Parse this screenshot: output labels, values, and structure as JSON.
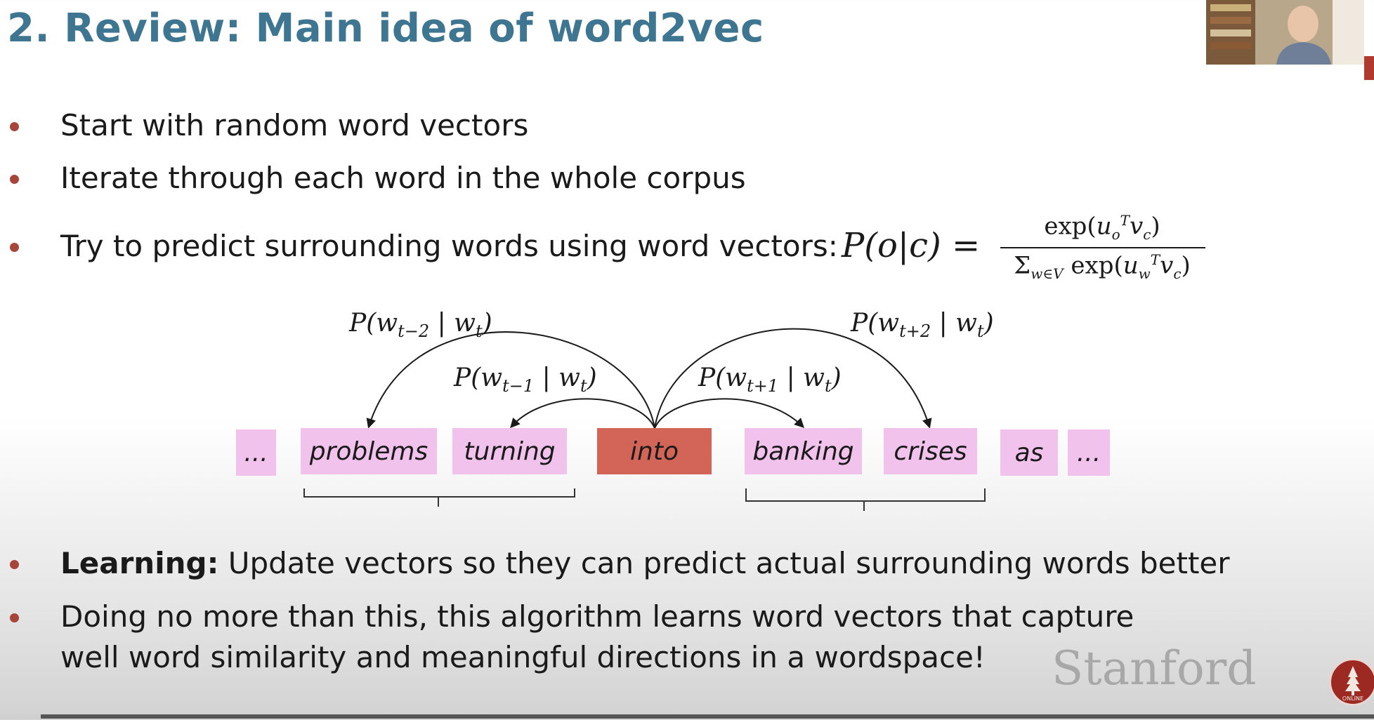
{
  "slide": {
    "title": "2. Review: Main idea of word2vec",
    "bullets": [
      "Start with random word vectors",
      "Iterate through each word in the whole corpus",
      "Try to predict surrounding words using word vectors:"
    ],
    "learning_label": "Learning:",
    "learning_text": " Update vectors so they can predict actual surrounding words better",
    "last_bullet_line1": "Doing no more than this, this algorithm learns word vectors that capture",
    "last_bullet_line2": "well word similarity and meaningful directions in a wordspace!"
  },
  "formula": {
    "lhs": "P(o|c) =",
    "numerator": "exp(u_o^T v_c)",
    "denominator": "Σ_{w∈V} exp(u_w^T v_c)"
  },
  "diagram": {
    "words": [
      "...",
      "problems",
      "turning",
      "into",
      "banking",
      "crises",
      "as",
      "..."
    ],
    "center_word": "into",
    "probabilities": {
      "t_minus_2": "P(w_{t−2} | w_t)",
      "t_minus_1": "P(w_{t−1} | w_t)",
      "t_plus_1": "P(w_{t+1} | w_t)",
      "t_plus_2": "P(w_{t+2} | w_t)"
    }
  },
  "branding": {
    "stanford": "Stanford",
    "logo_label": "ONLINE"
  },
  "colors": {
    "title": "#3e7590",
    "bullet_dot": "#a6463a",
    "context_word_box": "#f0c2ec",
    "center_word_box": "#d36558"
  },
  "icons": [
    "webcam-presenter-video",
    "stanford-online-logo-icon"
  ]
}
